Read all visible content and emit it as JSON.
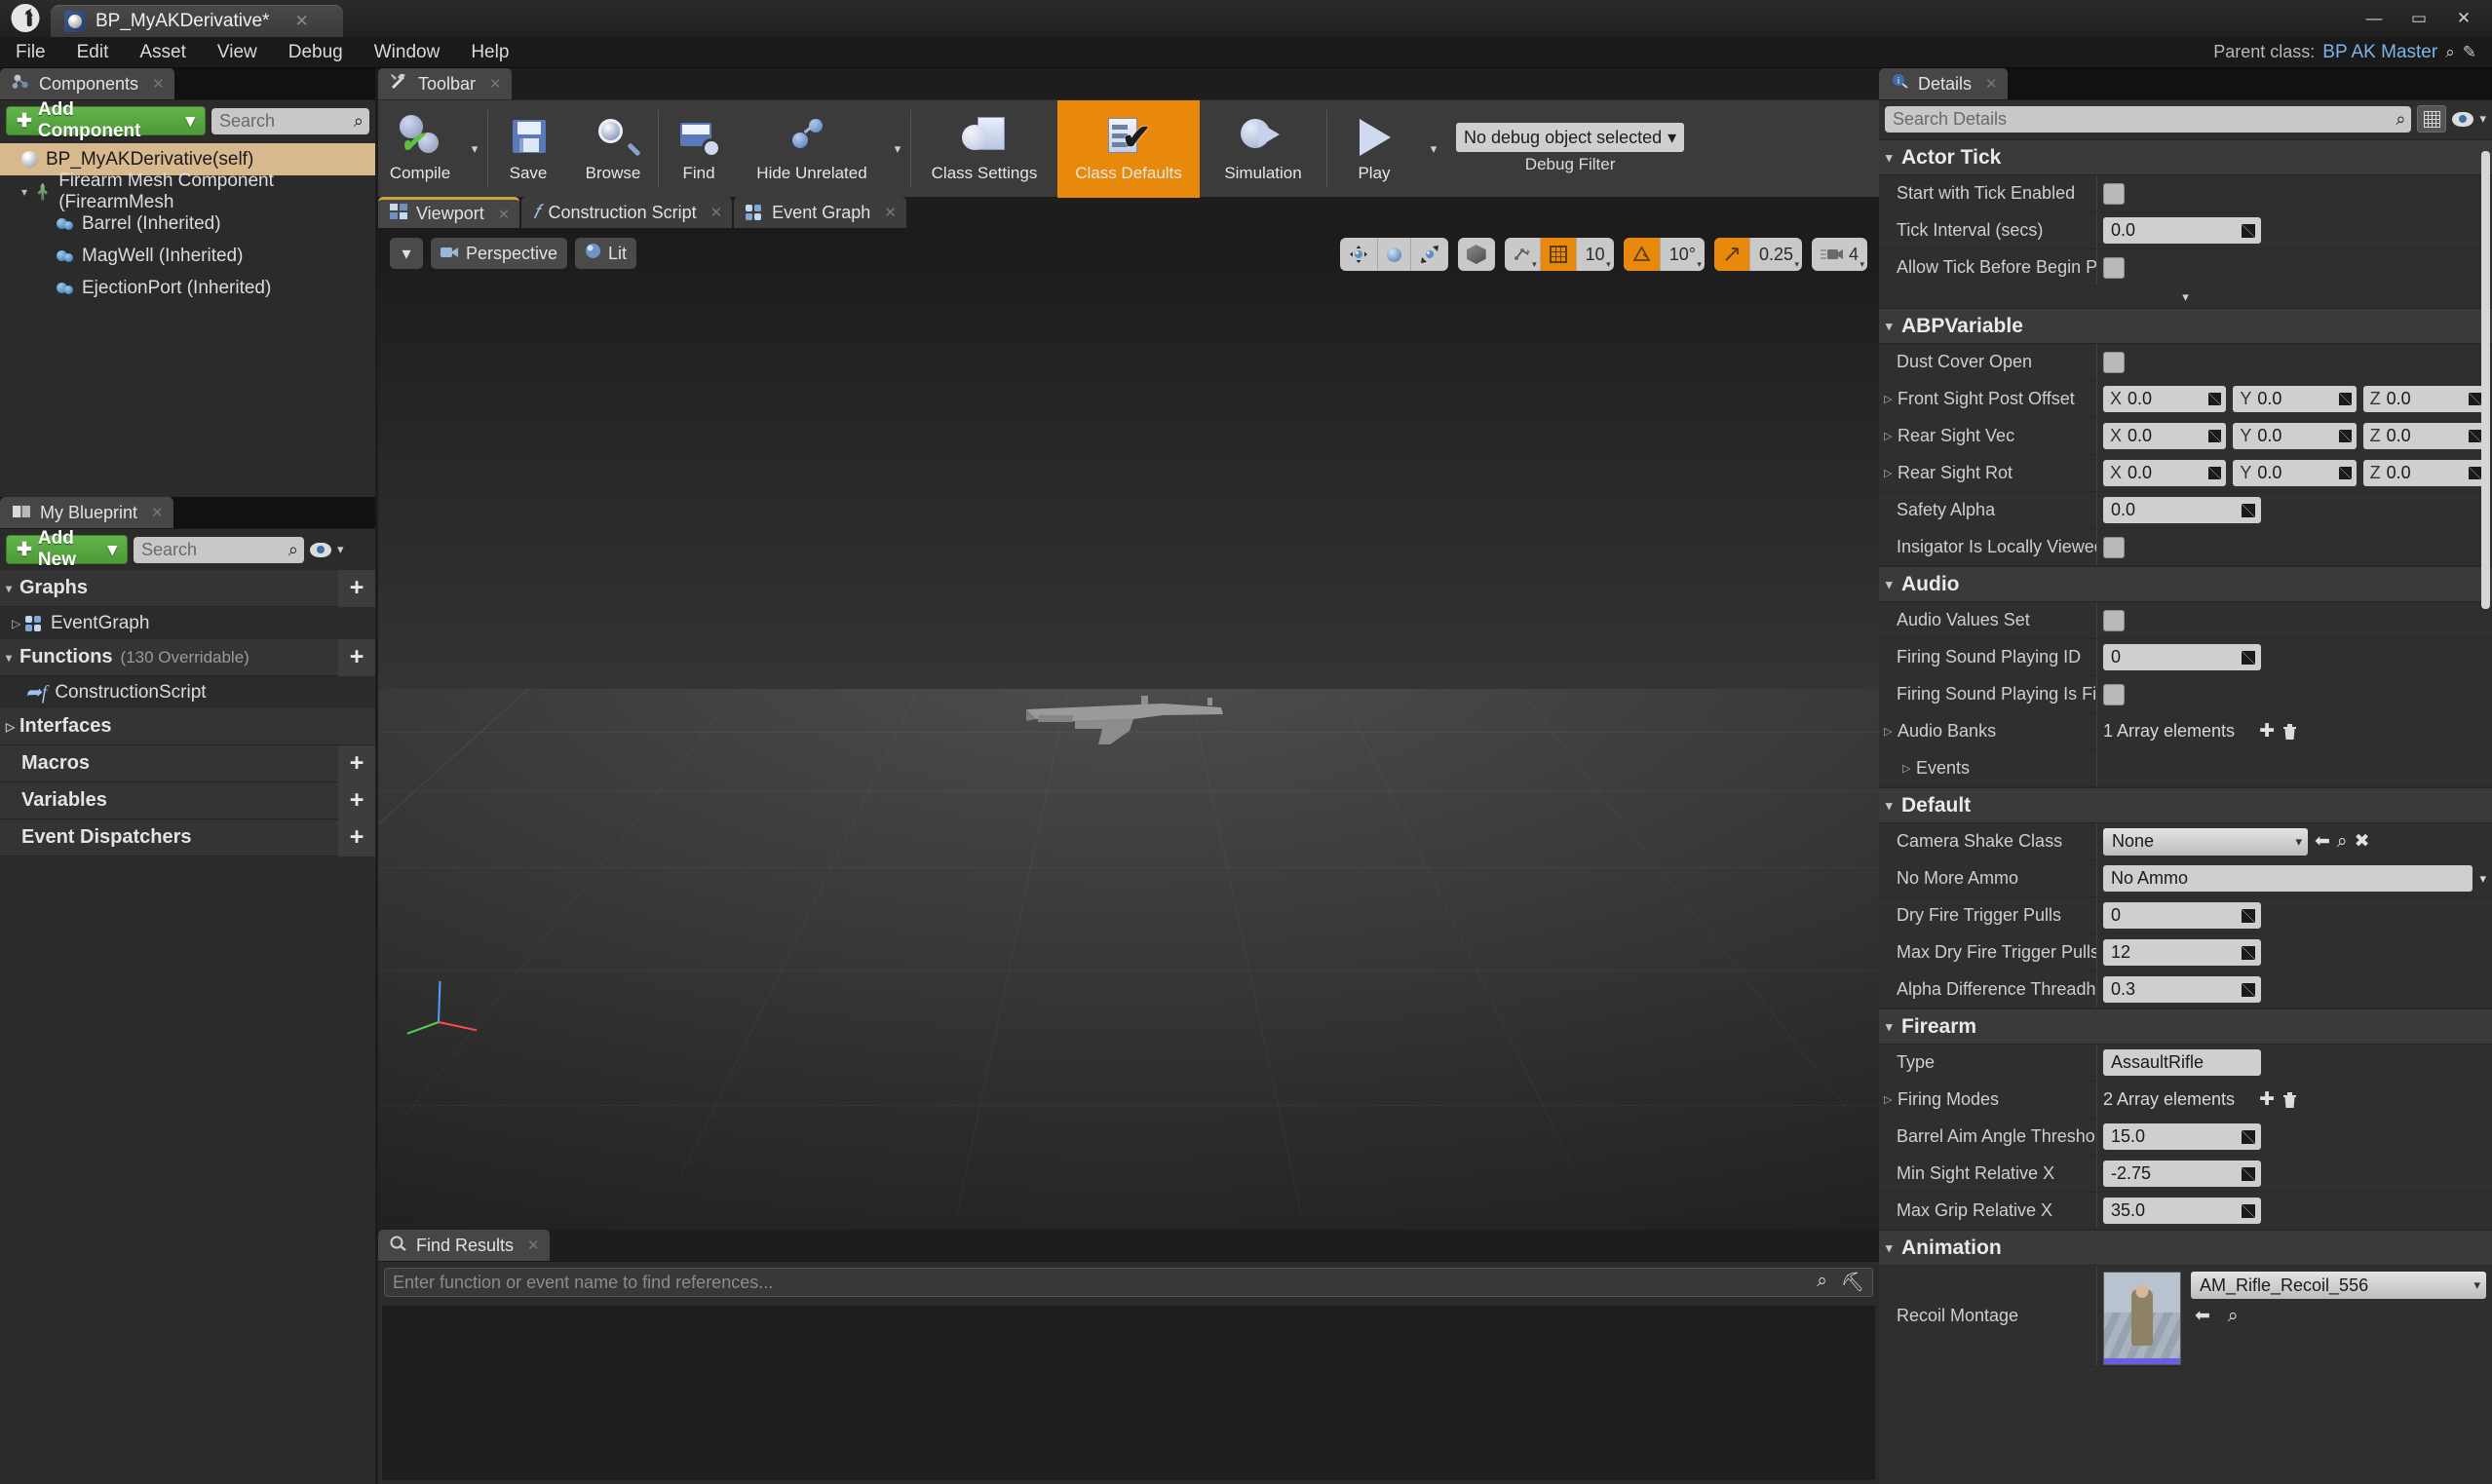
{
  "titlebar": {
    "logo": "unreal-logo",
    "tab_title": "BP_MyAKDerivative*",
    "close_glyph": "✕",
    "minimize_glyph": "—",
    "maximize_glyph": "▭",
    "window_close_glyph": "✕"
  },
  "menubar": {
    "items": [
      "File",
      "Edit",
      "Asset",
      "View",
      "Debug",
      "Window",
      "Help"
    ],
    "parent_class_label": "Parent class:",
    "parent_class_value": "BP AK Master",
    "browse_glyph": "⌕",
    "edit_glyph": "✎"
  },
  "components": {
    "tab_label": "Components",
    "tab_close": "✕",
    "add_button": "Add Component",
    "add_caret": "▾",
    "search_placeholder": "Search",
    "search_glyph": "⌕",
    "tree": [
      {
        "label": "BP_MyAKDerivative(self)",
        "icon": "sphere-icon",
        "indent": 0,
        "selected": true,
        "expander": ""
      },
      {
        "label": "Firearm Mesh Component (FirearmMesh",
        "icon": "skeletal-mesh-icon",
        "indent": 1,
        "selected": false,
        "expander": "▾"
      },
      {
        "label": "Barrel (Inherited)",
        "icon": "scene-component-icon",
        "indent": 2,
        "selected": false,
        "expander": ""
      },
      {
        "label": "MagWell (Inherited)",
        "icon": "scene-component-icon",
        "indent": 2,
        "selected": false,
        "expander": ""
      },
      {
        "label": "EjectionPort (Inherited)",
        "icon": "scene-component-icon",
        "indent": 2,
        "selected": false,
        "expander": ""
      }
    ]
  },
  "myblueprint": {
    "tab_label": "My Blueprint",
    "tab_close": "✕",
    "add_new_button": "Add New",
    "add_new_caret": "▾",
    "search_placeholder": "Search",
    "search_glyph": "⌕",
    "eye_caret": "▾",
    "sections": [
      {
        "label": "Graphs",
        "count": "",
        "expander": "▾",
        "plus": "+",
        "items": [
          {
            "label": "EventGraph",
            "icon": "event-graph-icon",
            "expander": "▷"
          }
        ]
      },
      {
        "label": "Functions",
        "count": "(130 Overridable)",
        "expander": "▾",
        "plus": "+",
        "items": [
          {
            "label": "ConstructionScript",
            "icon": "function-icon",
            "expander": ""
          }
        ]
      },
      {
        "label": "Interfaces",
        "count": "",
        "expander": "▷",
        "plus": "",
        "items": []
      },
      {
        "label": "Macros",
        "count": "",
        "expander": "",
        "plus": "+",
        "items": []
      },
      {
        "label": "Variables",
        "count": "",
        "expander": "",
        "plus": "+",
        "items": []
      },
      {
        "label": "Event Dispatchers",
        "count": "",
        "expander": "",
        "plus": "+",
        "items": []
      }
    ]
  },
  "toolbar": {
    "tab_label": "Toolbar",
    "tab_close": "✕",
    "buttons": [
      {
        "label": "Compile",
        "icon": "compile-icon",
        "caret": "▾",
        "active": false
      },
      {
        "label": "Save",
        "icon": "save-icon",
        "caret": "",
        "active": false
      },
      {
        "label": "Browse",
        "icon": "browse-icon",
        "caret": "",
        "active": false
      },
      {
        "label": "Find",
        "icon": "find-icon",
        "caret": "",
        "active": false
      },
      {
        "label": "Hide Unrelated",
        "icon": "hide-unrelated-icon",
        "caret": "▾",
        "active": false
      },
      {
        "label": "Class Settings",
        "icon": "class-settings-icon",
        "caret": "",
        "active": false
      },
      {
        "label": "Class Defaults",
        "icon": "class-defaults-icon",
        "caret": "",
        "active": true
      },
      {
        "label": "Simulation",
        "icon": "simulation-icon",
        "caret": "",
        "active": false
      },
      {
        "label": "Play",
        "icon": "play-icon",
        "caret": "▾",
        "active": false
      }
    ],
    "debug_object": "No debug object selected",
    "debug_caret": "▾",
    "debug_filter_label": "Debug Filter"
  },
  "viewport": {
    "tabs": [
      {
        "label": "Viewport",
        "icon": "viewport-icon",
        "close": "✕",
        "active": true
      },
      {
        "label": "Construction Script",
        "icon": "function-icon",
        "close": "✕",
        "active": false
      },
      {
        "label": "Event Graph",
        "icon": "event-graph-icon",
        "close": "✕",
        "active": false
      }
    ],
    "menu_caret": "▾",
    "view_mode": "Perspective",
    "view_mode_icon": "camera-icon",
    "lit_mode": "Lit",
    "lit_mode_icon": "lit-sphere-icon",
    "controls": {
      "translate_icon": "translate-gizmo-icon",
      "rotate_icon": "rotate-gizmo-icon",
      "scale_icon": "scale-gizmo-icon",
      "coord_icon": "world-space-icon",
      "surface_snap_icon": "surface-snap-icon",
      "grid_snap_icon": "grid-snap-icon",
      "grid_snap_value": "10",
      "angle_snap_icon": "angle-snap-icon",
      "angle_snap_value": "10°",
      "scale_snap_icon": "scale-snap-icon",
      "scale_snap_value": "0.25",
      "camera_speed_icon": "camera-speed-icon",
      "camera_speed_value": "4",
      "caret": "▾"
    }
  },
  "findresults": {
    "tab_label": "Find Results",
    "tab_icon": "find-results-icon",
    "tab_close": "✕",
    "search_placeholder": "Enter function or event name to find references...",
    "search_glyph": "⌕",
    "filter_glyph": "⛏"
  },
  "details": {
    "tab_label": "Details",
    "tab_icon": "details-info-icon",
    "tab_close": "✕",
    "search_placeholder": "Search Details",
    "search_glyph": "⌕",
    "grid_button_icon": "grid-view-icon",
    "eye_icon": "visibility-icon",
    "eye_caret": "▾",
    "categories": [
      {
        "name": "Actor Tick",
        "expander": "▾",
        "rows": [
          {
            "label": "Start with Tick Enabled",
            "type": "checkbox",
            "checked": false,
            "expander": ""
          },
          {
            "label": "Tick Interval (secs)",
            "type": "number",
            "value": "0.0",
            "expander": ""
          },
          {
            "label": "Allow Tick Before Begin Pla",
            "type": "checkbox",
            "checked": false,
            "expander": ""
          }
        ],
        "has_more_arrow": true,
        "more_arrow": "▾"
      },
      {
        "name": "ABPVariable",
        "expander": "▾",
        "rows": [
          {
            "label": "Dust Cover Open",
            "type": "checkbox",
            "checked": false,
            "expander": ""
          },
          {
            "label": "Front Sight Post Offset",
            "type": "vector",
            "x": "0.0",
            "y": "0.0",
            "z": "0.0",
            "expander": "▷"
          },
          {
            "label": "Rear Sight Vec",
            "type": "vector",
            "x": "0.0",
            "y": "0.0",
            "z": "0.0",
            "expander": "▷"
          },
          {
            "label": "Rear Sight Rot",
            "type": "vector",
            "x": "0.0",
            "y": "0.0",
            "z": "0.0",
            "expander": "▷"
          },
          {
            "label": "Safety Alpha",
            "type": "number",
            "value": "0.0",
            "expander": ""
          },
          {
            "label": "Insigator Is Locally Viewed",
            "type": "checkbox",
            "checked": false,
            "expander": ""
          }
        ],
        "has_more_arrow": false
      },
      {
        "name": "Audio",
        "expander": "▾",
        "rows": [
          {
            "label": "Audio Values Set",
            "type": "checkbox",
            "checked": false,
            "expander": ""
          },
          {
            "label": "Firing Sound Playing ID",
            "type": "number",
            "value": "0",
            "expander": ""
          },
          {
            "label": "Firing Sound Playing Is Fir",
            "type": "checkbox",
            "checked": false,
            "expander": ""
          },
          {
            "label": "Audio Banks",
            "type": "array",
            "value": "1 Array elements",
            "add_glyph": "✚",
            "delete_glyph": "🗑",
            "expander": "▷"
          },
          {
            "label": "Events",
            "type": "subgroup",
            "expander": "▷"
          }
        ],
        "has_more_arrow": false
      },
      {
        "name": "Default",
        "expander": "▾",
        "rows": [
          {
            "label": "Camera Shake Class",
            "type": "class-combo",
            "value": "None",
            "caret": "▾",
            "back_glyph": "⬅",
            "browse_glyph": "⌕",
            "clear_glyph": "✖",
            "expander": ""
          },
          {
            "label": "No More Ammo",
            "type": "enum-combo",
            "value": "No Ammo",
            "caret": "▾",
            "expander": ""
          },
          {
            "label": "Dry Fire Trigger Pulls",
            "type": "number",
            "value": "0",
            "expander": ""
          },
          {
            "label": "Max Dry Fire Trigger Pulls",
            "type": "number",
            "value": "12",
            "expander": ""
          },
          {
            "label": "Alpha Difference Threadho",
            "type": "number",
            "value": "0.3",
            "expander": ""
          }
        ],
        "has_more_arrow": false
      },
      {
        "name": "Firearm",
        "expander": "▾",
        "rows": [
          {
            "label": "Type",
            "type": "text",
            "value": "AssaultRifle",
            "expander": ""
          },
          {
            "label": "Firing Modes",
            "type": "array",
            "value": "2 Array elements",
            "add_glyph": "✚",
            "delete_glyph": "🗑",
            "expander": "▷"
          },
          {
            "label": "Barrel Aim Angle Threshol",
            "type": "number",
            "value": "15.0",
            "expander": ""
          },
          {
            "label": "Min Sight Relative X",
            "type": "number",
            "value": "-2.75",
            "expander": ""
          },
          {
            "label": "Max Grip Relative X",
            "type": "number",
            "value": "35.0",
            "expander": ""
          }
        ],
        "has_more_arrow": false
      },
      {
        "name": "Animation",
        "expander": "▾",
        "rows": [
          {
            "label": "Recoil Montage",
            "type": "asset",
            "value": "AM_Rifle_Recoil_556",
            "caret": "▾",
            "back_glyph": "⬅",
            "browse_glyph": "⌕",
            "thumbnail": "animation-thumbnail",
            "expander": ""
          }
        ],
        "has_more_arrow": false
      }
    ]
  },
  "colors": {
    "accent_orange": "#e8890c",
    "green_button": "#4c9a38",
    "selection_tan": "#d8b98e",
    "panel_bg": "#2b2b2b",
    "link_blue": "#7fb4e8"
  }
}
